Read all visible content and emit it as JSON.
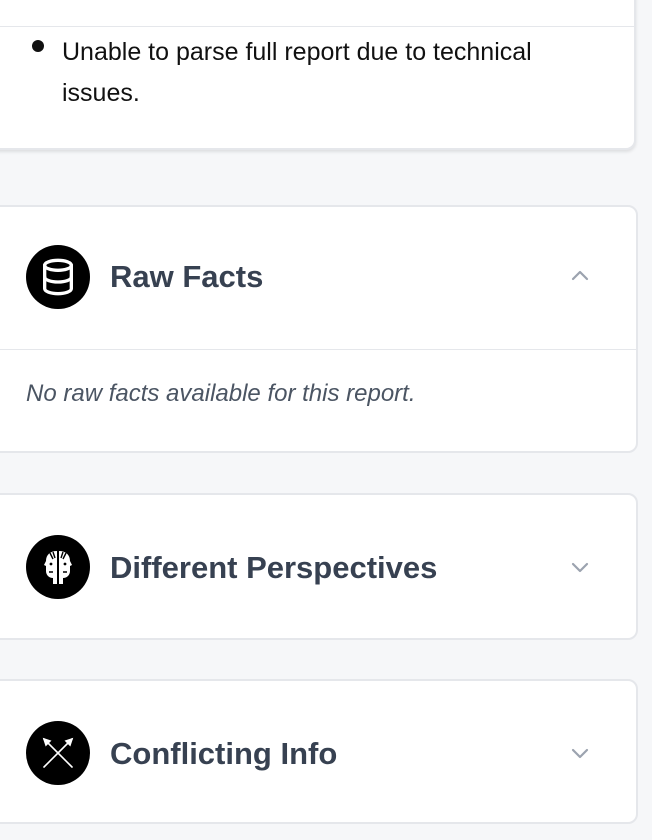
{
  "summary": {
    "bullet_text": "Unable to parse full report due to technical issues."
  },
  "sections": {
    "raw_facts": {
      "title": "Raw Facts",
      "icon": "database-icon",
      "expanded": true,
      "empty_message": "No raw facts available for this report."
    },
    "different_perspectives": {
      "title": "Different Perspectives",
      "icon": "two-faces-icon",
      "expanded": false
    },
    "conflicting_info": {
      "title": "Conflicting Info",
      "icon": "crossed-spears-icon",
      "expanded": false
    }
  },
  "colors": {
    "background": "#f6f7f9",
    "card": "#ffffff",
    "border": "#e5e7eb",
    "title": "#374151",
    "icon_bg": "#000000",
    "chevron": "#9ca3af"
  }
}
